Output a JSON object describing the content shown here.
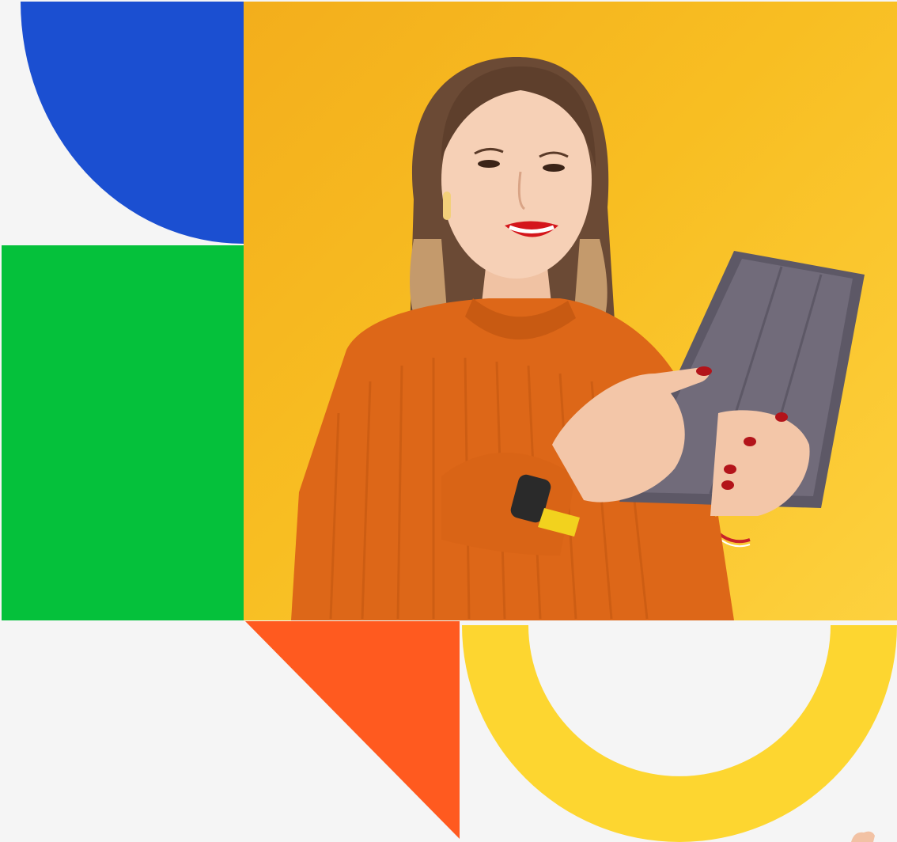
{
  "colors": {
    "background": "#f5f5f5",
    "blue": "#1b4fd1",
    "green": "#05c13b",
    "orange": "#ff5a1f",
    "yellow": "#fdd630",
    "photo_background": "#f8be22"
  },
  "photo": {
    "subject": "woman-with-tablet-photo",
    "alt": ""
  },
  "shapes": [
    "blue-quarter-circle",
    "green-rectangle",
    "orange-triangle",
    "yellow-semicircle-arc"
  ]
}
